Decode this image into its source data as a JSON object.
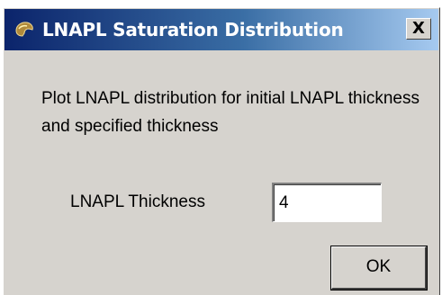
{
  "window": {
    "title": "LNAPL Saturation Distribution",
    "close_label": "X",
    "title_icon": "app-icon"
  },
  "message": "Plot LNAPL distribution for initial LNAPL thickness and specified thickness",
  "field": {
    "label": "LNAPL Thickness",
    "value": "4"
  },
  "buttons": {
    "ok_label": "OK"
  }
}
